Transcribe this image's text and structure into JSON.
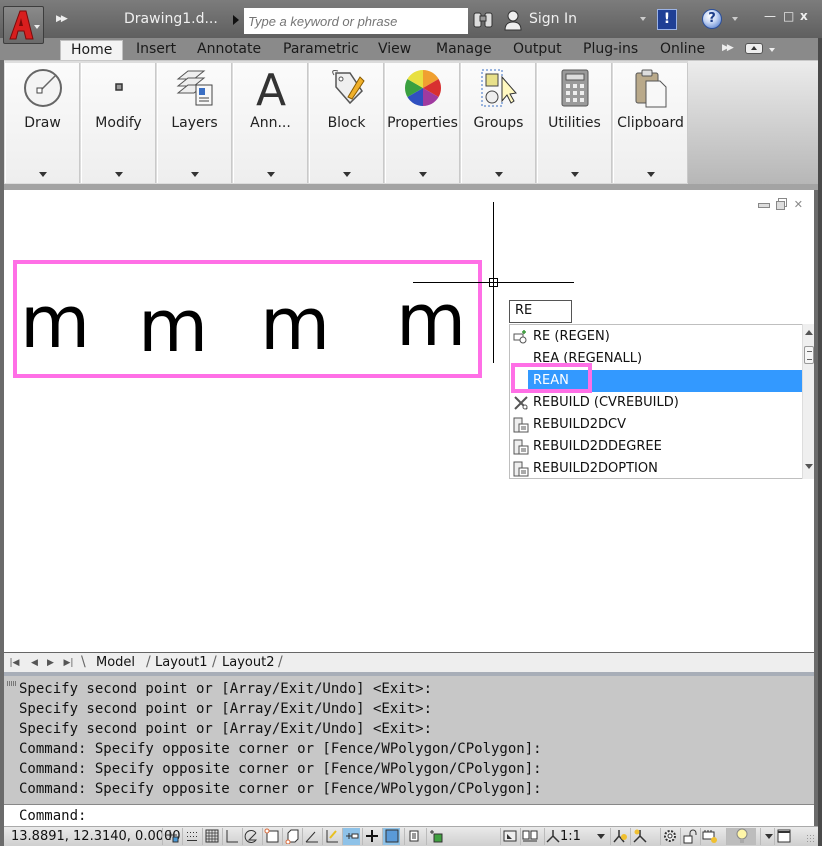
{
  "titlebar": {
    "document_title": "Drawing1.d...",
    "search_placeholder": "Type a keyword or phrase",
    "sign_in": "Sign In",
    "exchange_label": "!",
    "help_label": "?",
    "window_controls": {
      "minimize": "—",
      "maximize": "□",
      "close": "x"
    }
  },
  "ribbon": {
    "tabs": [
      {
        "label": "Home",
        "active": true
      },
      {
        "label": "Insert"
      },
      {
        "label": "Annotate"
      },
      {
        "label": "Parametric"
      },
      {
        "label": "View"
      },
      {
        "label": "Manage"
      },
      {
        "label": "Output"
      },
      {
        "label": "Plug-ins"
      },
      {
        "label": "Online"
      }
    ],
    "panels": [
      {
        "label": "Draw",
        "icon": "circle-radius-icon"
      },
      {
        "label": "Modify",
        "icon": "point-icon"
      },
      {
        "label": "Layers",
        "icon": "layers-icon"
      },
      {
        "label": "Ann...",
        "icon": "text-a-icon"
      },
      {
        "label": "Block",
        "icon": "block-tag-icon"
      },
      {
        "label": "Properties",
        "icon": "color-wheel-icon"
      },
      {
        "label": "Groups",
        "icon": "group-select-icon"
      },
      {
        "label": "Utilities",
        "icon": "calculator-icon"
      },
      {
        "label": "Clipboard",
        "icon": "clipboard-icon"
      }
    ]
  },
  "drawing": {
    "text_objects": [
      "m",
      "m",
      "m",
      "m"
    ],
    "highlight_color": "#ff6fe6",
    "dynamic_input_value": "RE",
    "autocomplete": [
      {
        "label": "RE (REGEN)",
        "icon": "regen-icon"
      },
      {
        "label": "REA (REGENALL)",
        "icon": ""
      },
      {
        "label": "REAN",
        "icon": "",
        "selected": true
      },
      {
        "label": "REBUILD (CVREBUILD)",
        "icon": "rebuild-tools-icon"
      },
      {
        "label": "REBUILD2DCV",
        "icon": "window-doc-icon"
      },
      {
        "label": "REBUILD2DDEGREE",
        "icon": "window-doc-icon"
      },
      {
        "label": "REBUILD2DOPTION",
        "icon": "window-doc-icon"
      }
    ],
    "selected_color": "#3399ff"
  },
  "layout_tabs": [
    "Model",
    "Layout1",
    "Layout2"
  ],
  "command_history": [
    "Specify second point or [Array/Exit/Undo] <Exit>:",
    "Specify second point or [Array/Exit/Undo] <Exit>:",
    "Specify second point or [Array/Exit/Undo] <Exit>:",
    "Command: Specify opposite corner or [Fence/WPolygon/CPolygon]:",
    "Command: Specify opposite corner or [Fence/WPolygon/CPolygon]:",
    "Command: Specify opposite corner or [Fence/WPolygon/CPolygon]:"
  ],
  "command_prompt": "Command:",
  "statusbar": {
    "coordinates": "13.8891, 12.3140, 0.0000",
    "annotation_scale": "1:1",
    "toggles": [
      {
        "name": "infer-constraints",
        "on": false
      },
      {
        "name": "snap-mode",
        "on": false
      },
      {
        "name": "grid-display",
        "on": false
      },
      {
        "name": "ortho-mode",
        "on": false
      },
      {
        "name": "polar-tracking",
        "on": false
      },
      {
        "name": "object-snap",
        "on": false
      },
      {
        "name": "3d-object-snap",
        "on": false
      },
      {
        "name": "object-snap-tracking",
        "on": false
      },
      {
        "name": "dynamic-ucs",
        "on": false
      },
      {
        "name": "dynamic-input",
        "on": true
      },
      {
        "name": "lineweight",
        "on": false
      },
      {
        "name": "transparency",
        "on": true
      },
      {
        "name": "quick-properties",
        "on": false
      },
      {
        "name": "selection-cycling",
        "on": false
      }
    ]
  }
}
